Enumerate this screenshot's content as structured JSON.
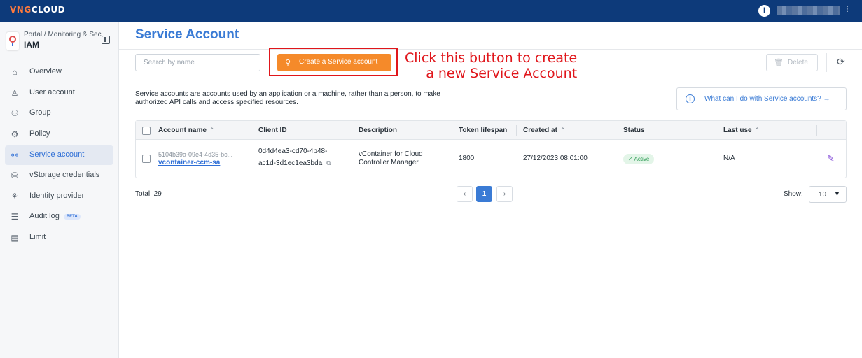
{
  "topbar": {
    "logo_left": "VNG",
    "logo_right": "CLOUD",
    "user_initial": "I",
    "user_caret": "⋮"
  },
  "sidebar": {
    "breadcrumb": "Portal / Monitoring & Sec",
    "app_name": "IAM",
    "items": [
      {
        "label": "Overview",
        "icon": "home-icon",
        "glyph": "⌂",
        "active": false
      },
      {
        "label": "User account",
        "icon": "user-icon",
        "glyph": "♙",
        "active": false
      },
      {
        "label": "Group",
        "icon": "group-icon",
        "glyph": "⚇",
        "active": false
      },
      {
        "label": "Policy",
        "icon": "policy-icon",
        "glyph": "⚙",
        "active": false
      },
      {
        "label": "Service account",
        "icon": "service-account-icon",
        "glyph": "⚯",
        "active": true
      },
      {
        "label": "vStorage credentials",
        "icon": "storage-icon",
        "glyph": "⛁",
        "active": false
      },
      {
        "label": "Identity provider",
        "icon": "identity-provider-icon",
        "glyph": "⚘",
        "active": false
      },
      {
        "label": "Audit log",
        "icon": "audit-log-icon",
        "glyph": "☰",
        "active": false,
        "badge": "BETA"
      },
      {
        "label": "Limit",
        "icon": "limit-icon",
        "glyph": "▤",
        "active": false
      }
    ]
  },
  "main": {
    "title": "Service Account",
    "search_placeholder": "Search by name",
    "create_button": "Create a Service account",
    "create_icon": "⚲",
    "annotation": "Click this button to create\na new Service Account",
    "delete_button": "Delete",
    "delete_icon": "🗑",
    "refresh_icon": "⟳",
    "description": "Service accounts are accounts used by an application or a machine, rather than a person, to make authorized API calls and access specified resources.",
    "help_link": "What can I do with Service accounts? →",
    "info_glyph": "i"
  },
  "table": {
    "headers": {
      "account_name": "Account name",
      "client_id": "Client ID",
      "description": "Description",
      "token_lifespan": "Token lifespan",
      "created_at": "Created at",
      "status": "Status",
      "last_use": "Last use"
    },
    "sort_glyph": "⌃",
    "rows": [
      {
        "account_id": "5104b39a-09e4-4d35-bc...",
        "account_name": "vcontainer-ccm-sa",
        "client_id_line1": "0d4d4ea3-cd70-4b48-",
        "client_id_line2": "ac1d-3d1ec1ea3bda",
        "copy_glyph": "⧉",
        "description_line1": "vContainer for Cloud",
        "description_line2": "Controller Manager",
        "token_lifespan": "1800",
        "created_at": "27/12/2023 08:01:00",
        "status": "✓ Active",
        "last_use": "N/A",
        "edit_glyph": "✎"
      }
    ]
  },
  "footer": {
    "total": "Total: 29",
    "prev": "‹",
    "current_page": "1",
    "next": "›",
    "show_label": "Show:",
    "page_size": "10",
    "caret": "▼"
  }
}
